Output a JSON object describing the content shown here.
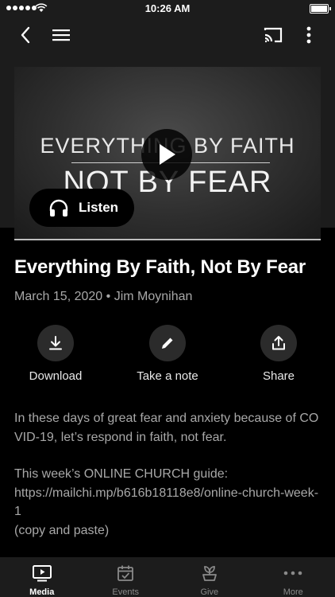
{
  "status_bar": {
    "time": "10:26 AM"
  },
  "video": {
    "line1": "EVERYTHING BY FAITH",
    "line2": "NOT BY FEAR",
    "listen_label": "Listen"
  },
  "sermon": {
    "title": "Everything By Faith, Not By Fear",
    "date": "March 15, 2020",
    "separator": "•",
    "speaker": "Jim Moynihan"
  },
  "actions": [
    {
      "label": "Download",
      "icon": "download-icon"
    },
    {
      "label": "Take a note",
      "icon": "pencil-icon"
    },
    {
      "label": "Share",
      "icon": "share-icon"
    }
  ],
  "description": {
    "paragraph1": "In these days of great fear and anxiety because of COVID-19, let’s respond in faith, not fear.",
    "paragraph2_line1": "This week’s ONLINE CHURCH guide:",
    "paragraph2_link": "https://mailchi.mp/b616b18118e8/online-church-week-1",
    "paragraph2_note": "(copy and paste)"
  },
  "tabs": [
    {
      "label": "Media",
      "icon": "media-icon",
      "active": true
    },
    {
      "label": "Events",
      "icon": "calendar-icon",
      "active": false
    },
    {
      "label": "Give",
      "icon": "plant-icon",
      "active": false
    },
    {
      "label": "More",
      "icon": "more-dots-icon",
      "active": false
    }
  ]
}
